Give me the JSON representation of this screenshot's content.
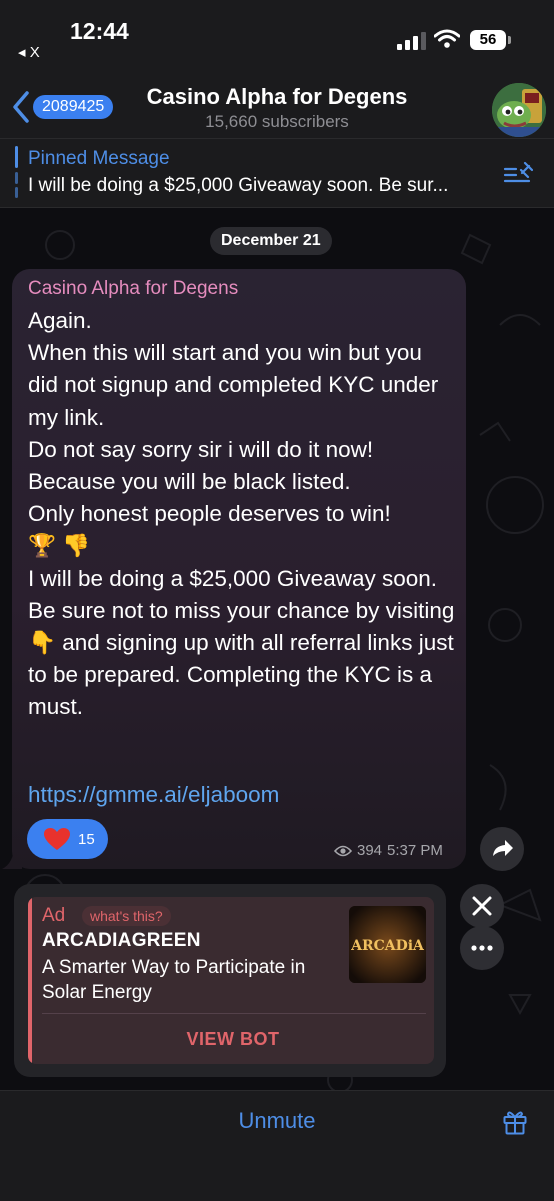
{
  "status_bar": {
    "time": "12:44",
    "back_app": "◂ X",
    "battery": "56"
  },
  "header": {
    "unread_count": "2089425",
    "title": "Casino Alpha for Degens",
    "subscribers": "15,660 subscribers"
  },
  "pinned": {
    "title": "Pinned Message",
    "text": "I will be doing a $25,000 Giveaway soon. Be sur..."
  },
  "date_separator": "December 21",
  "message": {
    "sender": "Casino Alpha for Degens",
    "lines": [
      "Again.",
      "When this will start and you win but you did not signup and completed KYC under my link.",
      "Do not say sorry sir i will do it now!",
      "Because you will be black listed.",
      "Only honest people deserves to win!",
      "🏆 👎",
      "I will be doing a $25,000 Giveaway soon.",
      "Be sure not to miss your chance by visiting 👇 and signing up with all referral links just to be prepared. Completing the KYC is a must."
    ],
    "link": "https://gmme.ai/eljaboom",
    "reaction_count": "15",
    "views": "394",
    "time": "5:37 PM"
  },
  "ad": {
    "label": "Ad",
    "whats_this": "what's this?",
    "title": "ARCADIAGREEN",
    "description": "A Smarter Way to Participate in Solar Energy",
    "image_text": "ARCADiA",
    "button": "VIEW BOT"
  },
  "bottom_bar": {
    "unmute": "Unmute"
  },
  "colors": {
    "accent": "#4e8ee6",
    "badge": "#3b80f0",
    "sender": "#e58cbe",
    "ad": "#e0656a",
    "link": "#5fa5ee"
  }
}
